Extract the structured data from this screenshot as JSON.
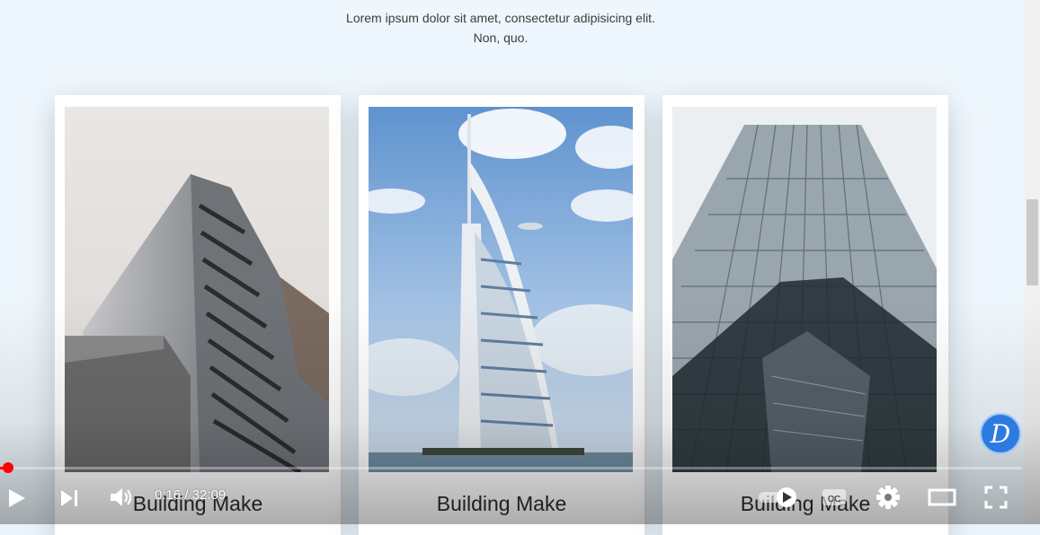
{
  "section": {
    "intro_text": "Lorem ipsum dolor sit amet, consectetur adipisicing elit. Non, quo."
  },
  "cards": [
    {
      "caption": "Building Make",
      "image": "modern-office-tower-photo"
    },
    {
      "caption": "Building Make",
      "image": "burj-al-arab-photo"
    },
    {
      "caption": "Building Make",
      "image": "glass-skyscraper-photo"
    }
  ],
  "player": {
    "time_display": "0:16 / 32:09",
    "progress": 0.0083,
    "accent_color": "#ff0000",
    "controls": [
      "play-icon",
      "next-icon",
      "volume-icon",
      "autoplay-toggle-icon",
      "subtitles-icon",
      "settings-icon",
      "theater-mode-icon",
      "fullscreen-icon"
    ]
  },
  "channel_badge": {
    "letter": "D",
    "color": "#2d7be0"
  }
}
